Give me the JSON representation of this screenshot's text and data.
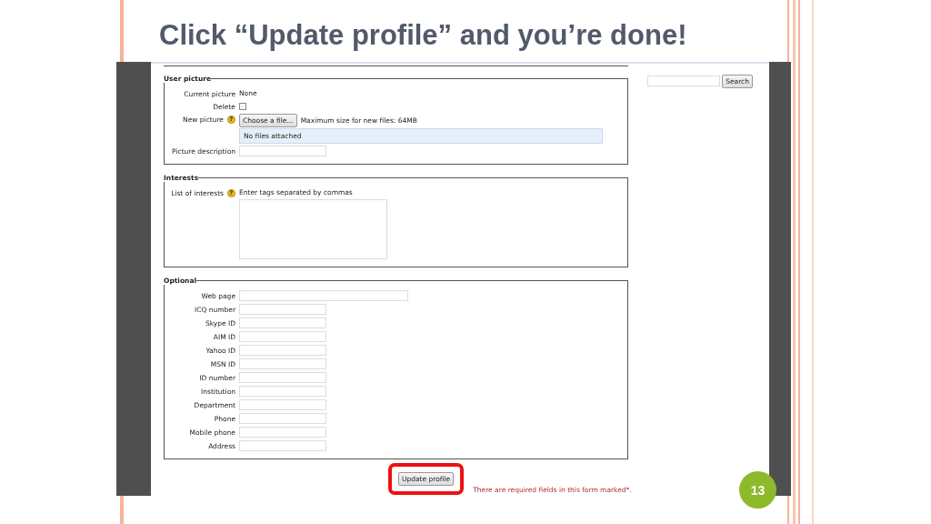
{
  "slide": {
    "title": "Click “Update profile” and you’re done!",
    "page_number": "13"
  },
  "form": {
    "sections": [
      {
        "legend": "User picture",
        "rows": [
          {
            "kind": "text",
            "label": "Current picture",
            "value": "None"
          },
          {
            "kind": "checkbox",
            "label": "Delete",
            "checked": false
          },
          {
            "kind": "file",
            "label": "New picture",
            "help": "?",
            "button": "Choose a file...",
            "note": "Maximum size for new files: 64MB",
            "status": "No files attached"
          },
          {
            "kind": "input",
            "label": "Picture description"
          }
        ]
      },
      {
        "legend": "Interests",
        "rows": [
          {
            "kind": "tags",
            "label": "List of interests",
            "help": "?",
            "hint": "Enter tags separated by commas"
          }
        ]
      },
      {
        "legend": "Optional",
        "rows": [
          {
            "kind": "input",
            "label": "Web page",
            "wide": true
          },
          {
            "kind": "input",
            "label": "ICQ number"
          },
          {
            "kind": "input",
            "label": "Skype ID"
          },
          {
            "kind": "input",
            "label": "AIM ID"
          },
          {
            "kind": "input",
            "label": "Yahoo ID"
          },
          {
            "kind": "input",
            "label": "MSN ID"
          },
          {
            "kind": "input",
            "label": "ID number"
          },
          {
            "kind": "input",
            "label": "Institution"
          },
          {
            "kind": "input",
            "label": "Department"
          },
          {
            "kind": "input",
            "label": "Phone"
          },
          {
            "kind": "input",
            "label": "Mobile phone"
          },
          {
            "kind": "input",
            "label": "Address"
          }
        ]
      }
    ],
    "submit": {
      "label": "Update profile",
      "highlighted": true
    },
    "required_note": "There are required fields in this form marked*."
  },
  "search": {
    "button": "Search"
  }
}
